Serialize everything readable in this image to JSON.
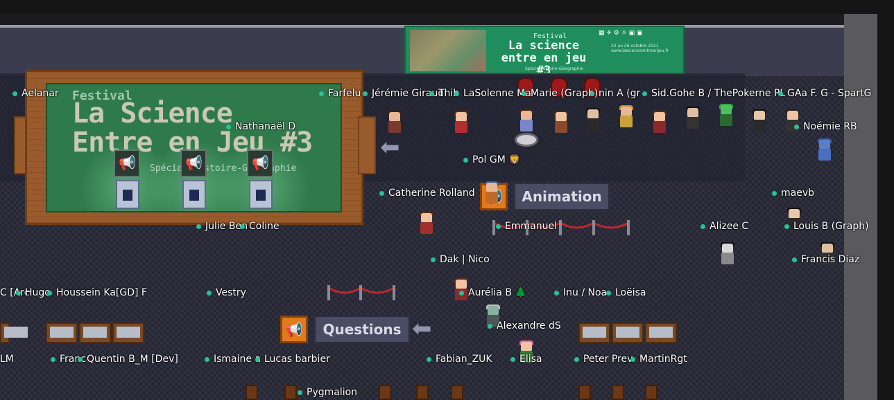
{
  "top_banner": {
    "festival": "Festival",
    "title_line1": "La science",
    "title_line2": "entre en jeu #3",
    "subtitle": "Spécial Histoire-Géographie",
    "dates": "22 au 26 octobre 2021",
    "url": "www.lascienceentreenjeu.fr"
  },
  "stage_screen": {
    "festival": "Festival",
    "line1": "La Science",
    "line2": "Entre en Jeu #3",
    "subtitle": "Spécial Histoire-Géographie"
  },
  "signs": {
    "animation": "Animation",
    "questions": "Questions"
  },
  "icons": {
    "megaphone": "megaphone-icon",
    "arrow": "arrow-left-icon"
  },
  "colors": {
    "status_dot": "#27c29a",
    "sign_icon": "#e07a1c",
    "banner_green": "#1f8d5c"
  },
  "players": [
    {
      "name": "Aelanar"
    },
    {
      "name": "Farfelu"
    },
    {
      "name": "Jérémie Giraud"
    },
    {
      "name": "Thib"
    },
    {
      "name": "LaSolenne Ma"
    },
    {
      "name": "Marie (Graph)"
    },
    {
      "name": "nin A (gr"
    },
    {
      "name": "Sid.Gohe B / ThePokerne PL"
    },
    {
      "name": "GAa F. G - SpartG"
    },
    {
      "name": "Nathanaël D"
    },
    {
      "name": "Noémie RB"
    },
    {
      "name": "Pol GM 🦁"
    },
    {
      "name": "Catherine Rolland"
    },
    {
      "name": "maevb"
    },
    {
      "name": "Julie Ben"
    },
    {
      "name": "Coline"
    },
    {
      "name": "Emmanuel"
    },
    {
      "name": "Alizee C"
    },
    {
      "name": "Louis B (Graph)"
    },
    {
      "name": "Dak | Nico"
    },
    {
      "name": "Francis Diaz"
    },
    {
      "name": "C [Arc"
    },
    {
      "name": "Hugo"
    },
    {
      "name": "Houssein Ka[GD] F"
    },
    {
      "name": "Vestry"
    },
    {
      "name": "Aurélia B 🌲"
    },
    {
      "name": "Inu / Noa"
    },
    {
      "name": "Loëisa"
    },
    {
      "name": "Alexandre dS"
    },
    {
      "name": "LM"
    },
    {
      "name": "Franc"
    },
    {
      "name": "Quentin B_M [Dev]"
    },
    {
      "name": "Ismaine a"
    },
    {
      "name": "Lucas barbier"
    },
    {
      "name": "Fabian_ZUK"
    },
    {
      "name": "Elisa"
    },
    {
      "name": "Peter Prev"
    },
    {
      "name": "MartinRgt"
    },
    {
      "name": "Pygmalion"
    }
  ]
}
